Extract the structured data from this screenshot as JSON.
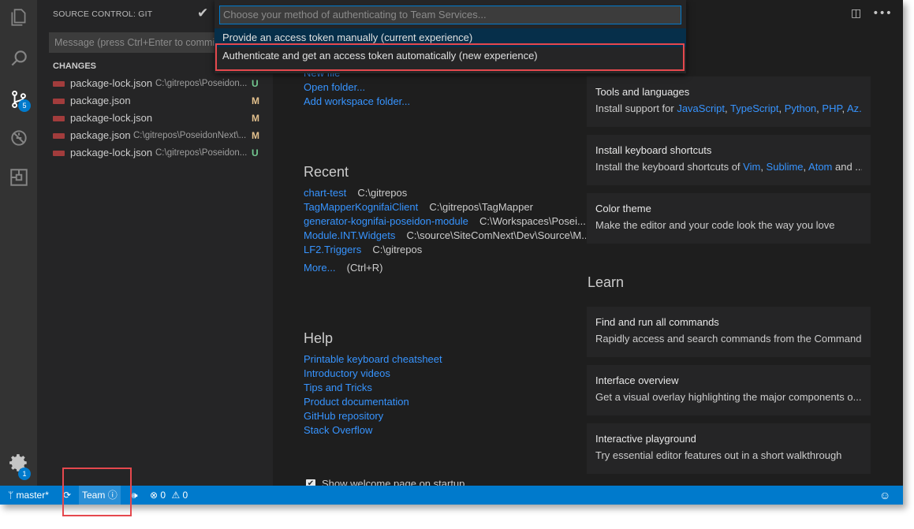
{
  "activity_bar": {
    "scm_badge": "5",
    "settings_badge": "1"
  },
  "sidebar": {
    "title": "SOURCE CONTROL: GIT",
    "commit_placeholder": "Message (press Ctrl+Enter to commit)",
    "changes_header": "CHANGES",
    "changes": [
      {
        "name": "package-lock.json",
        "path": "C:\\gitrepos\\Poseidon...",
        "status": "U"
      },
      {
        "name": "package.json",
        "path": "",
        "status": "M"
      },
      {
        "name": "package-lock.json",
        "path": "",
        "status": "M"
      },
      {
        "name": "package.json",
        "path": "C:\\gitrepos\\PoseidonNext\\...",
        "status": "M"
      },
      {
        "name": "package-lock.json",
        "path": "C:\\gitrepos\\Poseidon...",
        "status": "U"
      }
    ]
  },
  "quick_pick": {
    "placeholder": "Choose your method of authenticating to Team Services...",
    "items": [
      "Provide an access token manually (current experience)",
      "Authenticate and get an access token automatically (new experience)"
    ]
  },
  "welcome": {
    "start": {
      "new_file": "New file",
      "open_folder": "Open folder...",
      "add_workspace_folder": "Add workspace folder..."
    },
    "recent": {
      "heading": "Recent",
      "items": [
        {
          "name": "chart-test",
          "path": "C:\\gitrepos"
        },
        {
          "name": "TagMapperKognifaiClient",
          "path": "C:\\gitrepos\\TagMapper"
        },
        {
          "name": "generator-kognifai-poseidon-module",
          "path": "C:\\Workspaces\\Posei..."
        },
        {
          "name": "Module.INT.Widgets",
          "path": "C:\\source\\SiteComNext\\Dev\\Source\\M..."
        },
        {
          "name": "LF2.Triggers",
          "path": "C:\\gitrepos"
        }
      ],
      "more_label": "More...",
      "more_shortcut": "(Ctrl+R)"
    },
    "help": {
      "heading": "Help",
      "links": [
        "Printable keyboard cheatsheet",
        "Introductory videos",
        "Tips and Tricks",
        "Product documentation",
        "GitHub repository",
        "Stack Overflow"
      ]
    },
    "customize_cards": [
      {
        "title": "Tools and languages",
        "desc_prefix": "Install support for ",
        "links": [
          "JavaScript",
          "TypeScript",
          "Python",
          "PHP",
          "Az..."
        ]
      },
      {
        "title": "Install keyboard shortcuts",
        "desc_prefix": "Install the keyboard shortcuts of ",
        "links": [
          "Vim",
          "Sublime",
          "Atom"
        ],
        "desc_suffix": " and ..."
      },
      {
        "title": "Color theme",
        "desc": "Make the editor and your code look the way you love"
      }
    ],
    "learn": {
      "heading": "Learn",
      "cards": [
        {
          "title": "Find and run all commands",
          "desc": "Rapidly access and search commands from the Command..."
        },
        {
          "title": "Interface overview",
          "desc": "Get a visual overlay highlighting the major components o..."
        },
        {
          "title": "Interactive playground",
          "desc": "Try essential editor features out in a short walkthrough"
        }
      ]
    },
    "show_on_startup": "Show welcome page on startup"
  },
  "status_bar": {
    "branch": "master*",
    "team_label": "Team",
    "errors": "0",
    "warnings": "0"
  },
  "colors": {
    "activity_bar": "#333333",
    "sidebar": "#252526",
    "editor": "#1e1e1e",
    "status_bar": "#007acc",
    "link": "#3794ff",
    "untracked": "#73c991",
    "modified": "#e2c08d",
    "highlight": "#e5484d"
  }
}
